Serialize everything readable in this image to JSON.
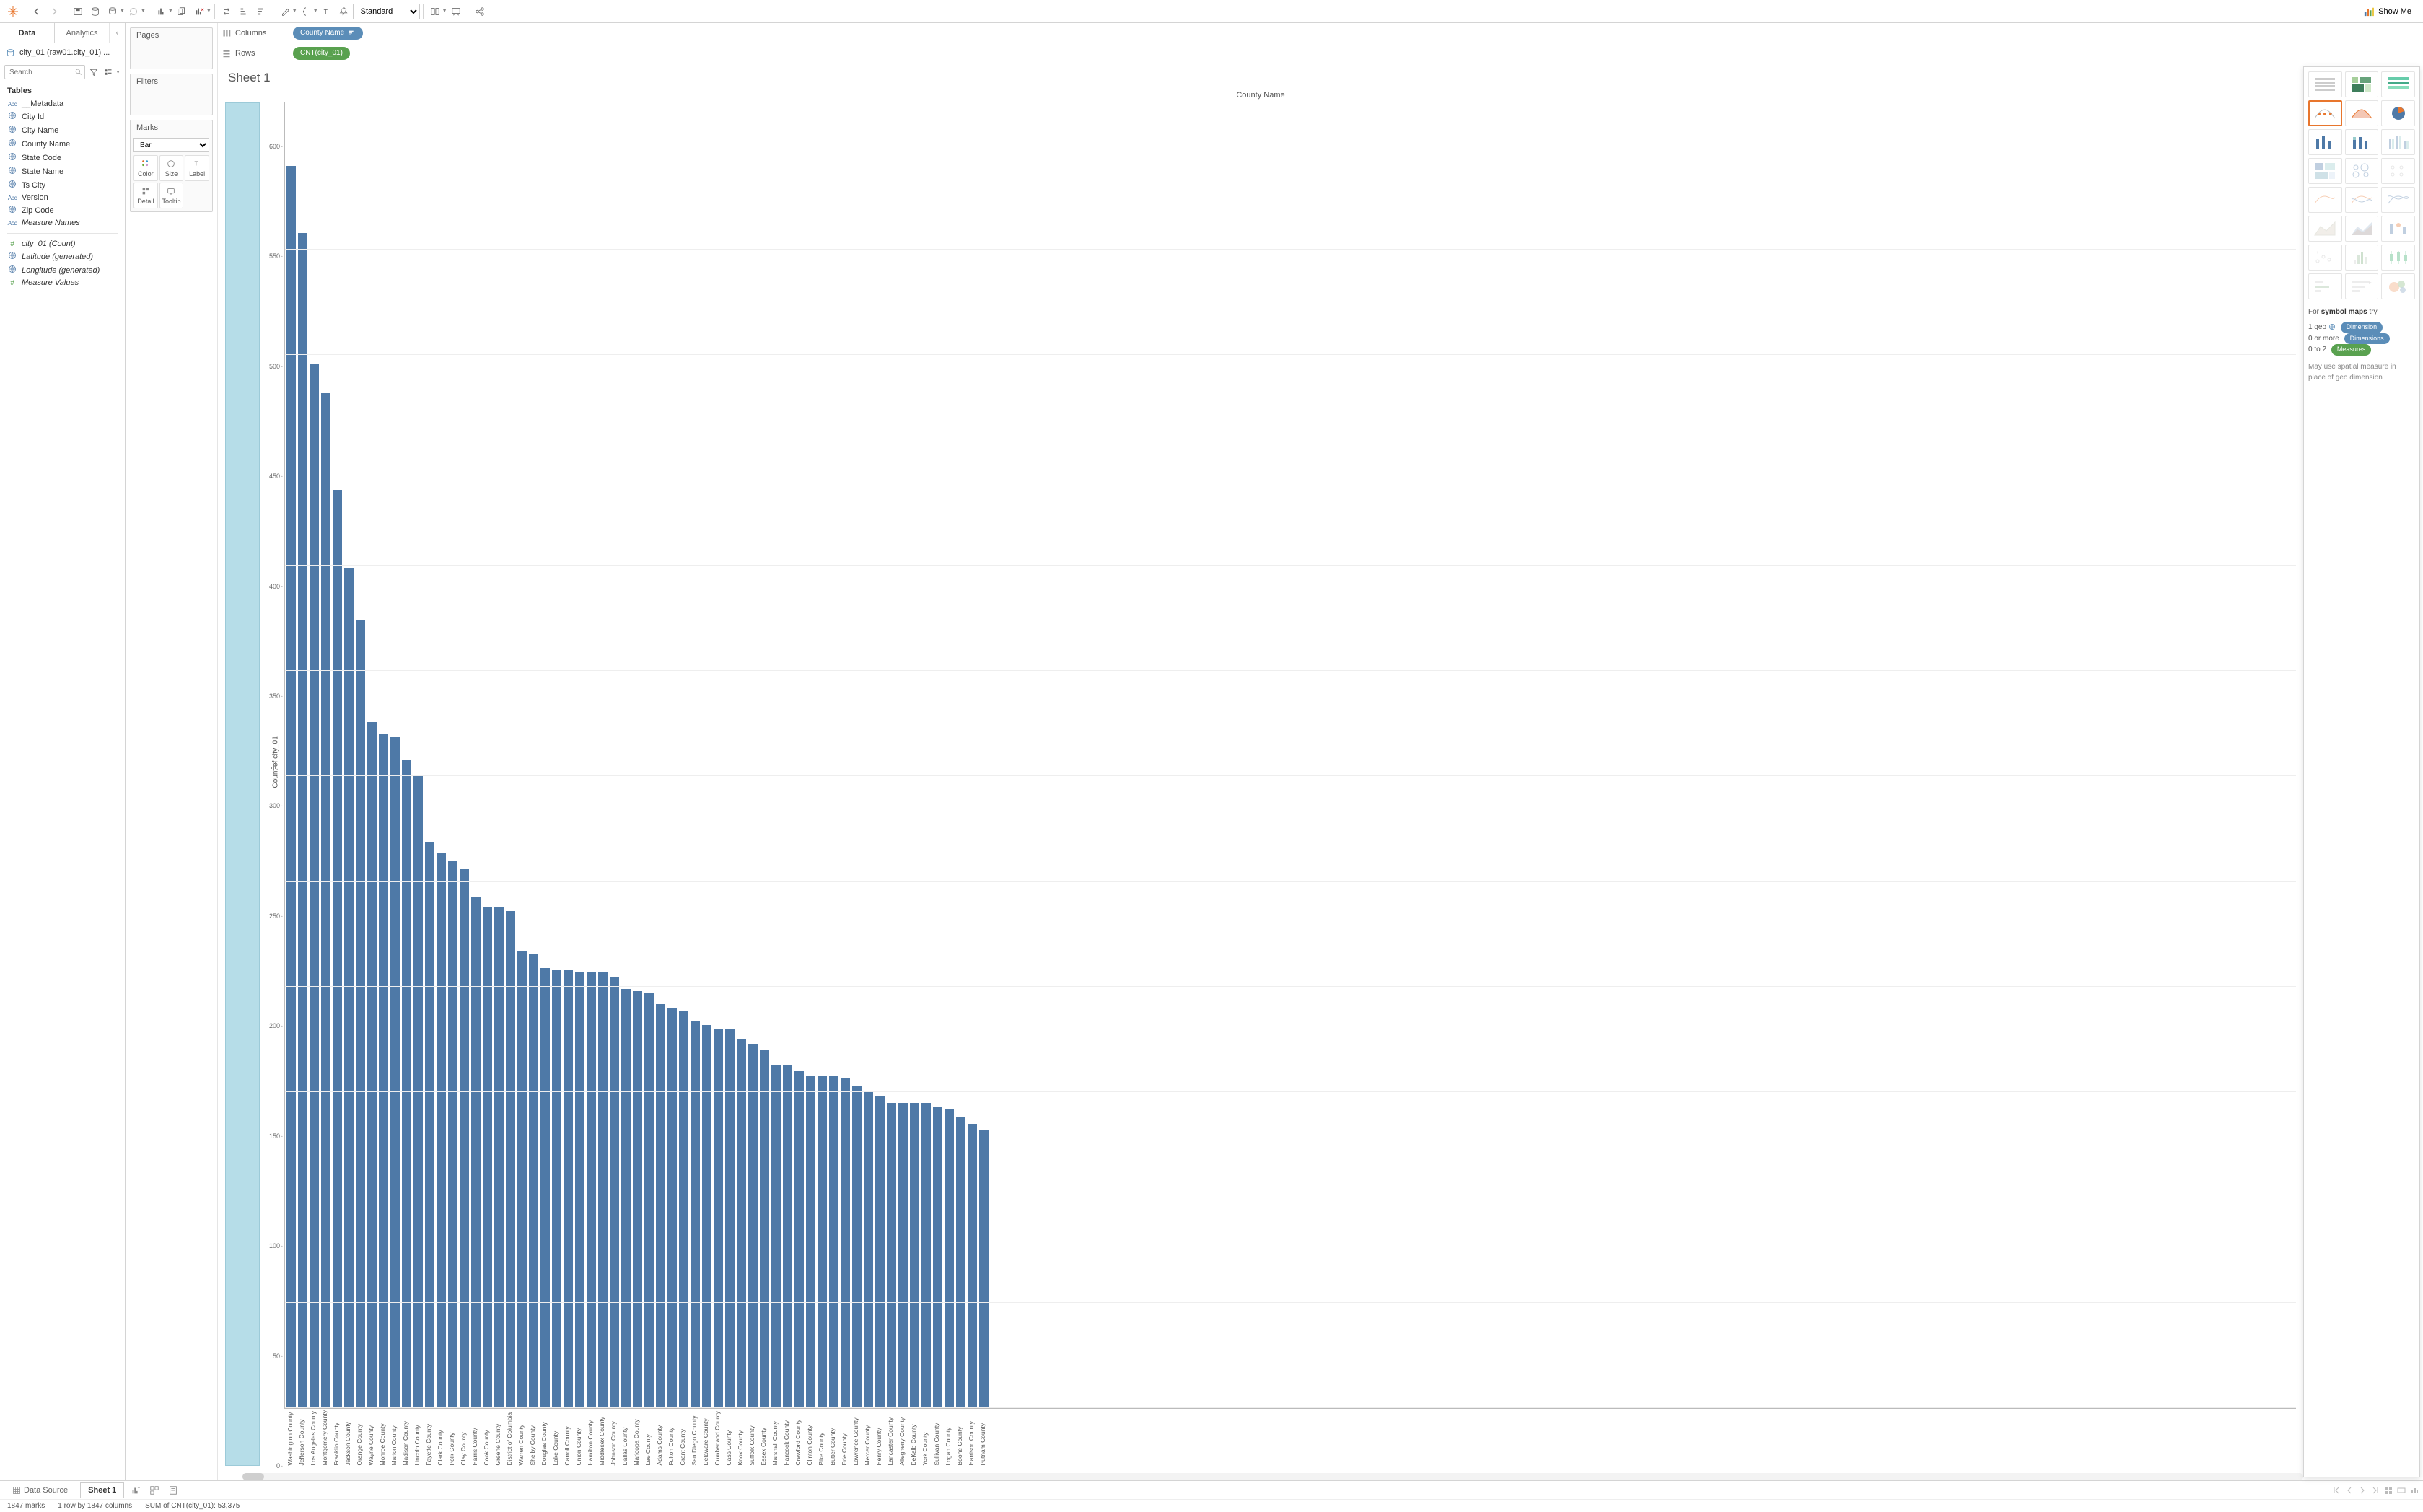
{
  "toolbar": {
    "format_select": "Standard",
    "showme_label": "Show Me"
  },
  "left_panel": {
    "tabs": {
      "data": "Data",
      "analytics": "Analytics"
    },
    "datasource": "city_01 (raw01.city_01) ...",
    "search_placeholder": "Search",
    "tables_header": "Tables",
    "fields": [
      {
        "icon": "abc",
        "label": "__Metadata"
      },
      {
        "icon": "globe",
        "label": "City Id"
      },
      {
        "icon": "globe",
        "label": "City Name"
      },
      {
        "icon": "globe",
        "label": "County Name"
      },
      {
        "icon": "globe",
        "label": "State Code"
      },
      {
        "icon": "globe",
        "label": "State Name"
      },
      {
        "icon": "globe",
        "label": "Ts City"
      },
      {
        "icon": "abc",
        "label": "Version"
      },
      {
        "icon": "globe",
        "label": "Zip Code"
      },
      {
        "icon": "abc",
        "label": "Measure Names",
        "italic": true
      }
    ],
    "gen_fields": [
      {
        "icon": "hash",
        "label": "city_01 (Count)",
        "italic": true
      },
      {
        "icon": "globe",
        "label": "Latitude (generated)",
        "italic": true
      },
      {
        "icon": "globe",
        "label": "Longitude (generated)",
        "italic": true
      },
      {
        "icon": "hash",
        "label": "Measure Values",
        "italic": true
      }
    ]
  },
  "shelves": {
    "pages": "Pages",
    "filters": "Filters",
    "marks": "Marks",
    "marks_type": "Bar",
    "marks_cells": [
      "Color",
      "Size",
      "Label",
      "Detail",
      "Tooltip"
    ]
  },
  "ws_shelves": {
    "columns_label": "Columns",
    "rows_label": "Rows",
    "columns_pill": "County Name",
    "rows_pill": "CNT(city_01)"
  },
  "sheet": {
    "title": "Sheet 1",
    "x_axis_title": "County Name",
    "y_axis_title": "Count of city_01"
  },
  "showme": {
    "hint_prefix": "For ",
    "hint_strong": "symbol maps",
    "hint_suffix": " try",
    "line1": "1 geo",
    "chip1": "Dimension",
    "line2": "0 or more",
    "chip2": "Dimensions",
    "line3": "0 to 2",
    "chip3": "Measures",
    "note": "May use spatial measure in place of geo dimension"
  },
  "bottom": {
    "data_source": "Data Source",
    "sheet_tab": "Sheet 1"
  },
  "status": {
    "marks": "1847 marks",
    "rows_cols": "1 row by 1847 columns",
    "sum": "SUM of CNT(city_01): 53,375"
  },
  "chart_data": {
    "type": "bar",
    "title": "Sheet 1",
    "xlabel": "County Name",
    "ylabel": "Count of city_01",
    "ylim": [
      0,
      620
    ],
    "y_ticks": [
      0,
      50,
      100,
      150,
      200,
      250,
      300,
      350,
      400,
      450,
      500,
      550,
      600
    ],
    "categories": [
      "Washington County",
      "Jefferson County",
      "Los Angeles County",
      "Montgomery County",
      "Franklin County",
      "Jackson County",
      "Orange County",
      "Wayne County",
      "Monroe County",
      "Marion County",
      "Madison County",
      "Lincoln County",
      "Fayette County",
      "Clark County",
      "Polk County",
      "Clay County",
      "Harris County",
      "Cook County",
      "Greene County",
      "District of Columbia",
      "Warren County",
      "Shelby County",
      "Douglas County",
      "Lake County",
      "Carroll County",
      "Union County",
      "Hamilton County",
      "Middlesex County",
      "Johnson County",
      "Dallas County",
      "Maricopa County",
      "Lee County",
      "Adams County",
      "Fulton County",
      "Grant County",
      "San Diego County",
      "Delaware County",
      "Cumberland County",
      "Cass County",
      "Knox County",
      "Suffolk County",
      "Essex County",
      "Marshall County",
      "Hancock County",
      "Crawford County",
      "Clinton County",
      "Pike County",
      "Butler County",
      "Erie County",
      "Lawrence County",
      "Mercer County",
      "Henry County",
      "Lancaster County",
      "Allegheny County",
      "DeKalb County",
      "York County",
      "Sullivan County",
      "Logan County",
      "Boone County",
      "Harrison County",
      "Putnam County"
    ],
    "values": [
      590,
      558,
      496,
      482,
      436,
      399,
      374,
      326,
      320,
      319,
      308,
      300,
      269,
      264,
      260,
      256,
      243,
      238,
      238,
      236,
      217,
      216,
      209,
      208,
      208,
      207,
      207,
      207,
      205,
      199,
      198,
      197,
      192,
      190,
      189,
      184,
      182,
      180,
      180,
      175,
      173,
      170,
      163,
      163,
      160,
      158,
      158,
      158,
      157,
      153,
      150,
      148,
      145,
      145,
      145,
      145,
      143,
      142,
      138,
      135,
      132
    ]
  }
}
